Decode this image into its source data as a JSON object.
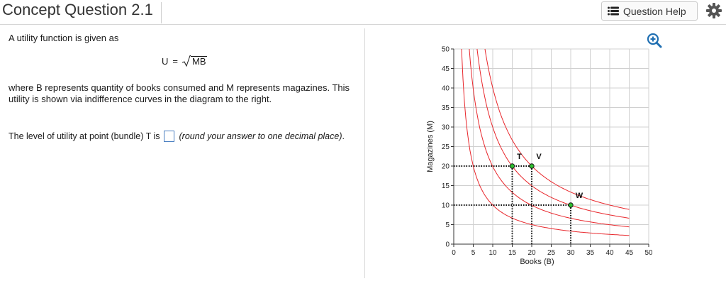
{
  "header": {
    "title": "Concept Question 2.1",
    "help_label": "Question Help"
  },
  "question": {
    "intro": "A utility function is given as",
    "equation": {
      "lhs": "U",
      "eq": "=",
      "radicand": "MB"
    },
    "description": "where B represents quantity of books consumed and M represents magazines. This utility is shown via indifference curves in the diagram to the right.",
    "prompt_before": "The level of utility at point (bundle) T is",
    "answer_value": "",
    "prompt_hint": "(round your answer to one decimal place)",
    "prompt_end": "."
  },
  "colors": {
    "curve": "#e8262b",
    "point": "#2fbf2f",
    "accent": "#1f6fb2",
    "grid": "#d0d0d0"
  },
  "chart_data": {
    "type": "line",
    "title": "",
    "xlabel": "Books (B)",
    "ylabel": "Magazines (M)",
    "xlim": [
      0,
      50
    ],
    "ylim": [
      0,
      50
    ],
    "xticks": [
      0,
      5,
      10,
      15,
      20,
      25,
      30,
      35,
      40,
      45,
      50
    ],
    "yticks": [
      0,
      5,
      10,
      15,
      20,
      25,
      30,
      35,
      40,
      45,
      50
    ],
    "grid": true,
    "indifference_curves_U": [
      10,
      14.1,
      17.3,
      20
    ],
    "curve_x_end": 45,
    "points": [
      {
        "label": "T",
        "x": 15,
        "y": 20
      },
      {
        "label": "V",
        "x": 20,
        "y": 20
      },
      {
        "label": "W",
        "x": 30,
        "y": 10
      }
    ]
  }
}
